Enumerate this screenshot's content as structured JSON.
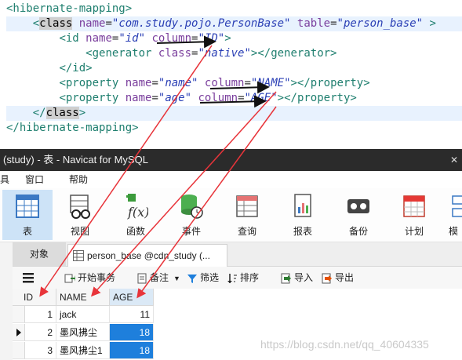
{
  "code": {
    "lines": [
      {
        "indent": "",
        "parts": [
          [
            "tag",
            "<hibernate-mapping>"
          ]
        ]
      },
      {
        "indent": "    ",
        "parts": [
          [
            "tag",
            "<"
          ],
          [
            "hlword",
            "class"
          ],
          [
            "plain",
            " "
          ],
          [
            "attr",
            "name"
          ],
          [
            "eq",
            "="
          ],
          [
            "val",
            "\"com.study.pojo.PersonBase\""
          ],
          [
            "plain",
            " "
          ],
          [
            "attr",
            "table"
          ],
          [
            "eq",
            "="
          ],
          [
            "val",
            "\"person_base\""
          ],
          [
            "tag",
            " >"
          ]
        ]
      },
      {
        "indent": "        ",
        "parts": [
          [
            "tag",
            "<id "
          ],
          [
            "attr",
            "name"
          ],
          [
            "eq",
            "="
          ],
          [
            "val",
            "\"id\""
          ],
          [
            "plain",
            " "
          ],
          [
            "attr",
            "column"
          ],
          [
            "eq",
            "="
          ],
          [
            "val",
            "\"ID\""
          ],
          [
            "tag",
            ">"
          ]
        ]
      },
      {
        "indent": "            ",
        "parts": [
          [
            "tag",
            "<generator "
          ],
          [
            "attr",
            "class"
          ],
          [
            "eq",
            "="
          ],
          [
            "val",
            "\"native\""
          ],
          [
            "tag",
            "></generator>"
          ]
        ]
      },
      {
        "indent": "        ",
        "parts": [
          [
            "tag",
            "</id>"
          ]
        ]
      },
      {
        "indent": "        ",
        "parts": [
          [
            "tag",
            "<property "
          ],
          [
            "attr",
            "name"
          ],
          [
            "eq",
            "="
          ],
          [
            "val",
            "\"name\""
          ],
          [
            "plain",
            " "
          ],
          [
            "attr",
            "column"
          ],
          [
            "eq",
            "="
          ],
          [
            "val",
            "\"NAME\""
          ],
          [
            "tag",
            "></property>"
          ]
        ]
      },
      {
        "indent": "        ",
        "parts": [
          [
            "tag",
            "<property "
          ],
          [
            "attr",
            "name"
          ],
          [
            "eq",
            "="
          ],
          [
            "val",
            "\"age\""
          ],
          [
            "plain",
            " "
          ],
          [
            "attr",
            "column"
          ],
          [
            "eq",
            "="
          ],
          [
            "val",
            "\"AGE\""
          ],
          [
            "tag",
            "></property>"
          ]
        ]
      },
      {
        "indent": "    ",
        "parts": [
          [
            "tag",
            "</"
          ],
          [
            "hlword",
            "class"
          ],
          [
            "tag",
            ">"
          ]
        ]
      },
      {
        "indent": "",
        "parts": [
          [
            "tag",
            "</hibernate-mapping>"
          ]
        ]
      }
    ]
  },
  "window": {
    "title": "(study) - 表 - Navicat for MySQL",
    "control": "✕"
  },
  "menu": [
    "具",
    "窗口",
    "帮助"
  ],
  "toolbar": [
    {
      "label": "表",
      "icon": "table-icon",
      "active": true
    },
    {
      "label": "视图",
      "icon": "view-icon"
    },
    {
      "label": "函数",
      "icon": "function-icon"
    },
    {
      "label": "事件",
      "icon": "event-icon"
    },
    {
      "label": "查询",
      "icon": "query-icon"
    },
    {
      "label": "报表",
      "icon": "report-icon"
    },
    {
      "label": "备份",
      "icon": "backup-icon"
    },
    {
      "label": "计划",
      "icon": "schedule-icon"
    },
    {
      "label": "模",
      "icon": "model-icon"
    }
  ],
  "tabs": {
    "objects": "对象",
    "doc": "person_base @cdn_study (..."
  },
  "gridbar": {
    "begin_tx": "开始事务",
    "note": "备注",
    "filter": "筛选",
    "sort": "排序",
    "import": "导入",
    "export": "导出"
  },
  "grid": {
    "columns": [
      "ID",
      "NAME",
      "AGE"
    ],
    "rows": [
      {
        "id": "1",
        "name": "jack",
        "age": "11",
        "current": false,
        "selected": false
      },
      {
        "id": "2",
        "name": "墨风拂尘",
        "age": "18",
        "current": true,
        "selected": true
      },
      {
        "id": "3",
        "name": "墨风拂尘1",
        "age": "18",
        "current": false,
        "selected": true
      }
    ]
  },
  "watermark": "https://blog.csdn.net/qq_40604335",
  "colors": {
    "arrow": "#e8343a",
    "selection": "#1e7fdc",
    "titlebar": "#2b2b2b"
  }
}
